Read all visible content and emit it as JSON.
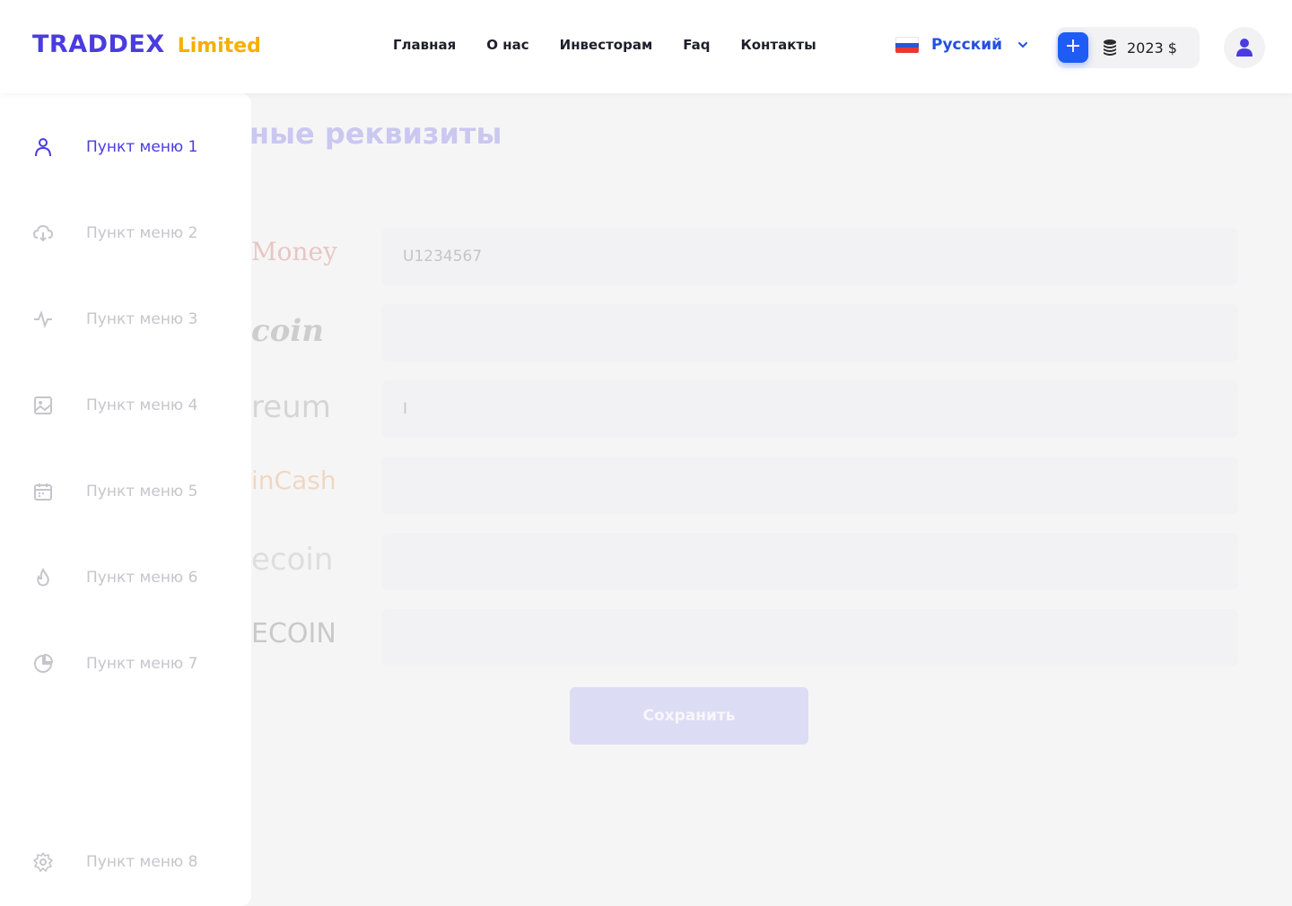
{
  "header": {
    "logo_main": "TRADDEX",
    "logo_sub": "Limited",
    "nav": [
      "Главная",
      "О нас",
      "Инвесторам",
      "Faq",
      "Контакты"
    ],
    "language": "Русский",
    "add_label": "+",
    "balance": "2023 $"
  },
  "sidebar": {
    "items": [
      {
        "label": "Пункт меню 1",
        "icon": "user-icon",
        "active": true
      },
      {
        "label": "Пункт меню 2",
        "icon": "cloud-download-icon",
        "active": false
      },
      {
        "label": "Пункт меню 3",
        "icon": "activity-icon",
        "active": false
      },
      {
        "label": "Пункт меню 4",
        "icon": "image-icon",
        "active": false
      },
      {
        "label": "Пункт меню 5",
        "icon": "calendar-icon",
        "active": false
      },
      {
        "label": "Пункт меню 6",
        "icon": "flame-icon",
        "active": false
      },
      {
        "label": "Пункт меню 7",
        "icon": "pie-chart-icon",
        "active": false
      },
      {
        "label": "Пункт меню 8",
        "icon": "gear-icon",
        "active": false
      }
    ]
  },
  "main": {
    "title": "ные реквизиты",
    "wallets": [
      {
        "logo": "Money",
        "value": "U1234567"
      },
      {
        "logo": "coin",
        "value": ""
      },
      {
        "logo": "reum",
        "value": "I"
      },
      {
        "logo": "inCash",
        "value": ""
      },
      {
        "logo": "ecoin",
        "value": ""
      },
      {
        "logo": "ECOIN",
        "value": ""
      }
    ],
    "save_label": "Сохранить"
  },
  "colors": {
    "brand": "#4a3ce0",
    "accent": "#f5b000",
    "link": "#2450e0",
    "button": "#1f5cf5"
  }
}
